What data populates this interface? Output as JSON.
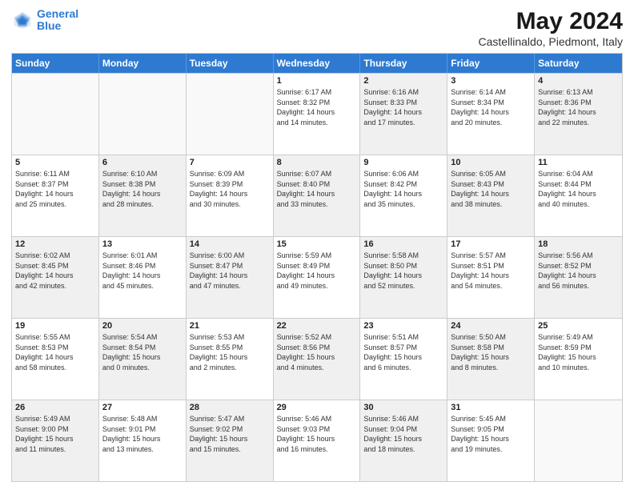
{
  "header": {
    "logo_line1": "General",
    "logo_line2": "Blue",
    "title": "May 2024",
    "subtitle": "Castellinaldo, Piedmont, Italy"
  },
  "calendar": {
    "days_of_week": [
      "Sunday",
      "Monday",
      "Tuesday",
      "Wednesday",
      "Thursday",
      "Friday",
      "Saturday"
    ],
    "weeks": [
      [
        {
          "day": "",
          "info": "",
          "empty": true
        },
        {
          "day": "",
          "info": "",
          "empty": true
        },
        {
          "day": "",
          "info": "",
          "empty": true
        },
        {
          "day": "1",
          "info": "Sunrise: 6:17 AM\nSunset: 8:32 PM\nDaylight: 14 hours\nand 14 minutes.",
          "shaded": false
        },
        {
          "day": "2",
          "info": "Sunrise: 6:16 AM\nSunset: 8:33 PM\nDaylight: 14 hours\nand 17 minutes.",
          "shaded": true
        },
        {
          "day": "3",
          "info": "Sunrise: 6:14 AM\nSunset: 8:34 PM\nDaylight: 14 hours\nand 20 minutes.",
          "shaded": false
        },
        {
          "day": "4",
          "info": "Sunrise: 6:13 AM\nSunset: 8:36 PM\nDaylight: 14 hours\nand 22 minutes.",
          "shaded": true
        }
      ],
      [
        {
          "day": "5",
          "info": "Sunrise: 6:11 AM\nSunset: 8:37 PM\nDaylight: 14 hours\nand 25 minutes.",
          "shaded": false
        },
        {
          "day": "6",
          "info": "Sunrise: 6:10 AM\nSunset: 8:38 PM\nDaylight: 14 hours\nand 28 minutes.",
          "shaded": true
        },
        {
          "day": "7",
          "info": "Sunrise: 6:09 AM\nSunset: 8:39 PM\nDaylight: 14 hours\nand 30 minutes.",
          "shaded": false
        },
        {
          "day": "8",
          "info": "Sunrise: 6:07 AM\nSunset: 8:40 PM\nDaylight: 14 hours\nand 33 minutes.",
          "shaded": true
        },
        {
          "day": "9",
          "info": "Sunrise: 6:06 AM\nSunset: 8:42 PM\nDaylight: 14 hours\nand 35 minutes.",
          "shaded": false
        },
        {
          "day": "10",
          "info": "Sunrise: 6:05 AM\nSunset: 8:43 PM\nDaylight: 14 hours\nand 38 minutes.",
          "shaded": true
        },
        {
          "day": "11",
          "info": "Sunrise: 6:04 AM\nSunset: 8:44 PM\nDaylight: 14 hours\nand 40 minutes.",
          "shaded": false
        }
      ],
      [
        {
          "day": "12",
          "info": "Sunrise: 6:02 AM\nSunset: 8:45 PM\nDaylight: 14 hours\nand 42 minutes.",
          "shaded": true
        },
        {
          "day": "13",
          "info": "Sunrise: 6:01 AM\nSunset: 8:46 PM\nDaylight: 14 hours\nand 45 minutes.",
          "shaded": false
        },
        {
          "day": "14",
          "info": "Sunrise: 6:00 AM\nSunset: 8:47 PM\nDaylight: 14 hours\nand 47 minutes.",
          "shaded": true
        },
        {
          "day": "15",
          "info": "Sunrise: 5:59 AM\nSunset: 8:49 PM\nDaylight: 14 hours\nand 49 minutes.",
          "shaded": false
        },
        {
          "day": "16",
          "info": "Sunrise: 5:58 AM\nSunset: 8:50 PM\nDaylight: 14 hours\nand 52 minutes.",
          "shaded": true
        },
        {
          "day": "17",
          "info": "Sunrise: 5:57 AM\nSunset: 8:51 PM\nDaylight: 14 hours\nand 54 minutes.",
          "shaded": false
        },
        {
          "day": "18",
          "info": "Sunrise: 5:56 AM\nSunset: 8:52 PM\nDaylight: 14 hours\nand 56 minutes.",
          "shaded": true
        }
      ],
      [
        {
          "day": "19",
          "info": "Sunrise: 5:55 AM\nSunset: 8:53 PM\nDaylight: 14 hours\nand 58 minutes.",
          "shaded": false
        },
        {
          "day": "20",
          "info": "Sunrise: 5:54 AM\nSunset: 8:54 PM\nDaylight: 15 hours\nand 0 minutes.",
          "shaded": true
        },
        {
          "day": "21",
          "info": "Sunrise: 5:53 AM\nSunset: 8:55 PM\nDaylight: 15 hours\nand 2 minutes.",
          "shaded": false
        },
        {
          "day": "22",
          "info": "Sunrise: 5:52 AM\nSunset: 8:56 PM\nDaylight: 15 hours\nand 4 minutes.",
          "shaded": true
        },
        {
          "day": "23",
          "info": "Sunrise: 5:51 AM\nSunset: 8:57 PM\nDaylight: 15 hours\nand 6 minutes.",
          "shaded": false
        },
        {
          "day": "24",
          "info": "Sunrise: 5:50 AM\nSunset: 8:58 PM\nDaylight: 15 hours\nand 8 minutes.",
          "shaded": true
        },
        {
          "day": "25",
          "info": "Sunrise: 5:49 AM\nSunset: 8:59 PM\nDaylight: 15 hours\nand 10 minutes.",
          "shaded": false
        }
      ],
      [
        {
          "day": "26",
          "info": "Sunrise: 5:49 AM\nSunset: 9:00 PM\nDaylight: 15 hours\nand 11 minutes.",
          "shaded": true
        },
        {
          "day": "27",
          "info": "Sunrise: 5:48 AM\nSunset: 9:01 PM\nDaylight: 15 hours\nand 13 minutes.",
          "shaded": false
        },
        {
          "day": "28",
          "info": "Sunrise: 5:47 AM\nSunset: 9:02 PM\nDaylight: 15 hours\nand 15 minutes.",
          "shaded": true
        },
        {
          "day": "29",
          "info": "Sunrise: 5:46 AM\nSunset: 9:03 PM\nDaylight: 15 hours\nand 16 minutes.",
          "shaded": false
        },
        {
          "day": "30",
          "info": "Sunrise: 5:46 AM\nSunset: 9:04 PM\nDaylight: 15 hours\nand 18 minutes.",
          "shaded": true
        },
        {
          "day": "31",
          "info": "Sunrise: 5:45 AM\nSunset: 9:05 PM\nDaylight: 15 hours\nand 19 minutes.",
          "shaded": false
        },
        {
          "day": "",
          "info": "",
          "empty": true
        }
      ]
    ]
  }
}
